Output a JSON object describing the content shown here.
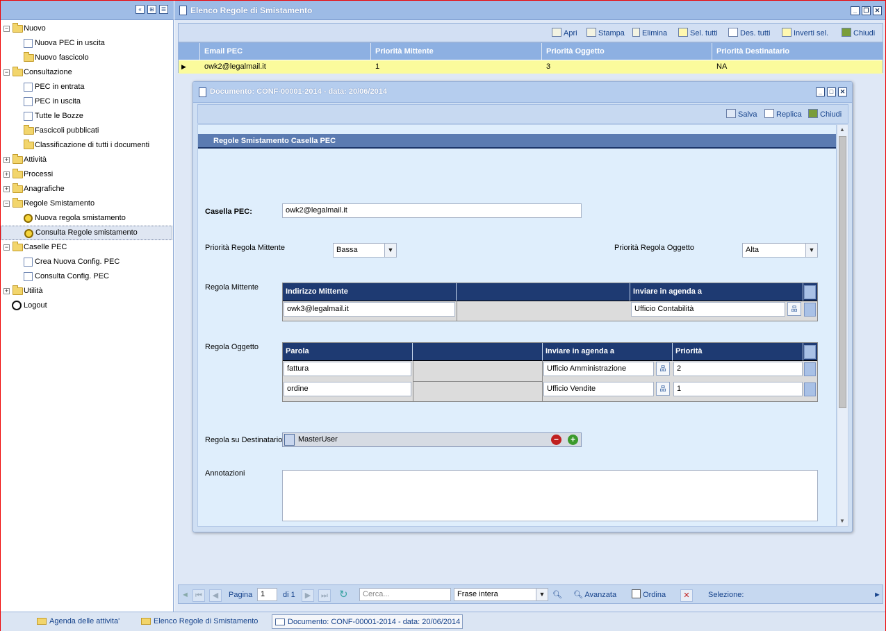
{
  "sidebar": {
    "items": [
      {
        "label": "Nuovo",
        "level": 0,
        "icon": "folder-open-icon",
        "expanded": true
      },
      {
        "label": "Nuova PEC in uscita",
        "level": 1,
        "icon": "document-icon"
      },
      {
        "label": "Nuovo fascicolo",
        "level": 1,
        "icon": "folder-document-icon"
      },
      {
        "label": "Consultazione",
        "level": 0,
        "icon": "folder-open-icon",
        "expanded": true
      },
      {
        "label": "PEC in entrata",
        "level": 1,
        "icon": "mail-document-icon"
      },
      {
        "label": "PEC in uscita",
        "level": 1,
        "icon": "mail-document-icon"
      },
      {
        "label": "Tutte le Bozze",
        "level": 1,
        "icon": "draft-icon"
      },
      {
        "label": "Fascicoli pubblicati",
        "level": 1,
        "icon": "folder-document-icon"
      },
      {
        "label": "Classificazione di tutti i documenti",
        "level": 1,
        "icon": "folders-icon"
      },
      {
        "label": "Attività",
        "level": 0,
        "icon": "folder-icon",
        "expanded": false
      },
      {
        "label": "Processi",
        "level": 0,
        "icon": "folder-icon",
        "expanded": false
      },
      {
        "label": "Anagrafiche",
        "level": 0,
        "icon": "folder-icon",
        "expanded": false
      },
      {
        "label": "Regole Smistamento",
        "level": 0,
        "icon": "folder-open-icon",
        "expanded": true
      },
      {
        "label": "Nuova regola smistamento",
        "level": 1,
        "icon": "gear-icon"
      },
      {
        "label": "Consulta Regole smistamento",
        "level": 1,
        "icon": "gear-icon",
        "selected": true
      },
      {
        "label": "Caselle PEC",
        "level": 0,
        "icon": "folder-open-icon",
        "expanded": true
      },
      {
        "label": "Crea Nuova Config. PEC",
        "level": 1,
        "icon": "config-icon"
      },
      {
        "label": "Consulta Config. PEC",
        "level": 1,
        "icon": "config-icon"
      },
      {
        "label": "Utilità",
        "level": 0,
        "icon": "folder-icon",
        "expanded": false
      },
      {
        "label": "Logout",
        "level": 0,
        "icon": "power-icon"
      }
    ]
  },
  "main_window": {
    "title": "Elenco Regole di Smistamento",
    "toolbar": [
      "Apri",
      "Stampa",
      "Elimina",
      "Sel. tutti",
      "Des. tutti",
      "Inverti sel.",
      "Chiudi"
    ],
    "grid": {
      "columns": [
        "Email PEC",
        "Priorità Mittente",
        "Priorità Oggetto",
        "Priorità Destinatario"
      ],
      "rows": [
        [
          "owk2@legalmail.it",
          "1",
          "3",
          "NA"
        ]
      ]
    }
  },
  "doc_window": {
    "title": "Documento: CONF-00001-2014 - data: 20/06/2014",
    "toolbar": [
      "Salva",
      "Replica",
      "Chiudi"
    ],
    "section_title": "Regole Smistamento Casella PEC",
    "casella_label": "Casella PEC:",
    "casella_value": "owk2@legalmail.it",
    "prio_mittente_label": "Priorità Regola Mittente",
    "prio_mittente_value": "Bassa",
    "prio_oggetto_label": "Priorità Regola Oggetto",
    "prio_oggetto_value": "Alta",
    "regola_mittente_label": "Regola Mittente",
    "mittente_table": {
      "headers": [
        "Indirizzo Mittente",
        "",
        "Inviare in agenda a"
      ],
      "rows": [
        [
          "owk3@legalmail.it",
          "",
          "Ufficio Contabilità"
        ]
      ]
    },
    "regola_oggetto_label": "Regola Oggetto",
    "oggetto_table": {
      "headers": [
        "Parola",
        "",
        "Inviare in agenda a",
        "Priorità"
      ],
      "rows": [
        [
          "fattura",
          "",
          "Ufficio Amministrazione",
          "2"
        ],
        [
          "ordine",
          "",
          "Ufficio Vendite",
          "1"
        ]
      ]
    },
    "regola_destinatario_label": "Regola su Destinatario",
    "destinatario_value": "MasterUser",
    "annotazioni_label": "Annotazioni",
    "annotazioni_value": ""
  },
  "pager": {
    "page_label": "Pagina",
    "page_value": "1",
    "of_label": "di 1",
    "search_placeholder": "Cerca...",
    "search_mode": "Frase intera",
    "advanced_label": "Avanzata",
    "sort_label": "Ordina",
    "selection_label": "Selezione:"
  },
  "taskbar": [
    {
      "label": "Agenda delle attivita'",
      "active": false
    },
    {
      "label": "Elenco Regole di Smistamento",
      "active": false
    },
    {
      "label": "Documento: CONF-00001-2014 - data: 20/06/2014",
      "active": true
    }
  ]
}
